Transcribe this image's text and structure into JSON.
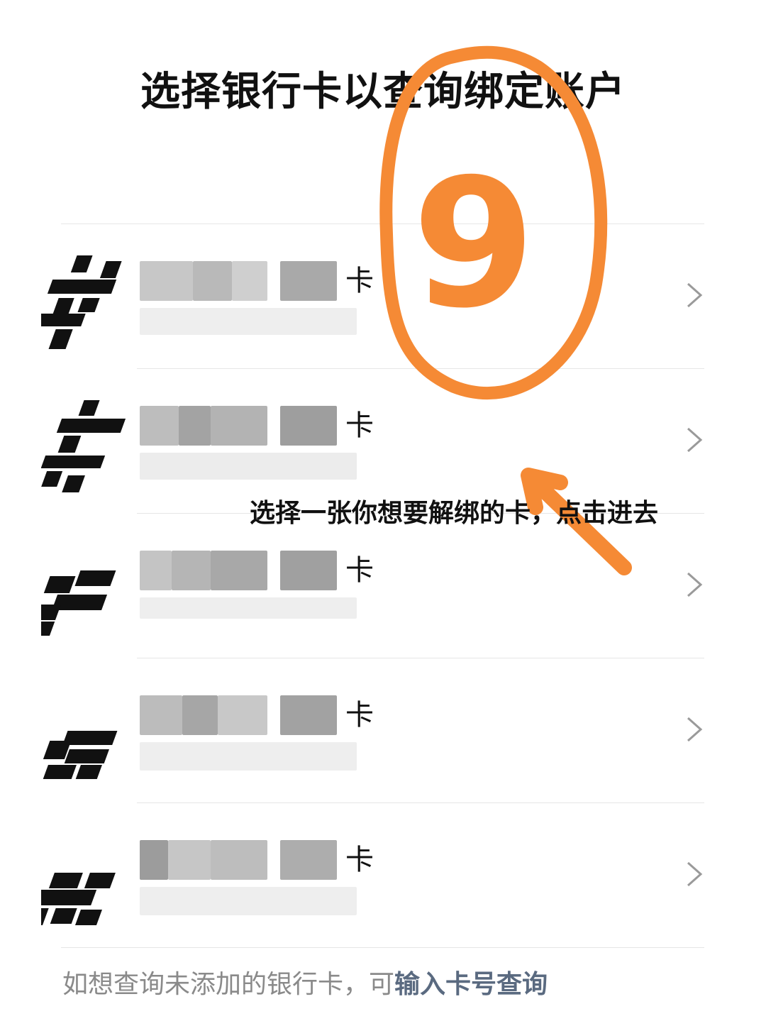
{
  "page": {
    "title": "选择银行卡以查询绑定账户"
  },
  "cards": [
    {
      "name_suffix": "卡"
    },
    {
      "name_suffix": "卡"
    },
    {
      "name_suffix": "卡"
    },
    {
      "name_suffix": "卡"
    },
    {
      "name_suffix": "卡"
    }
  ],
  "footer": {
    "prefix": "如想查询未添加的银行卡，可",
    "link": "输入卡号查询"
  },
  "annotation": {
    "number": "9",
    "instruction": "选择一张你想要解绑的卡，点击进去"
  },
  "colors": {
    "annotation_orange": "#f58a35",
    "link": "#5a6a80",
    "footer_text": "#8a8a8a"
  },
  "icons": {
    "chevron": "chevron-right-icon",
    "bank_logo": "bank-logo-icon"
  }
}
